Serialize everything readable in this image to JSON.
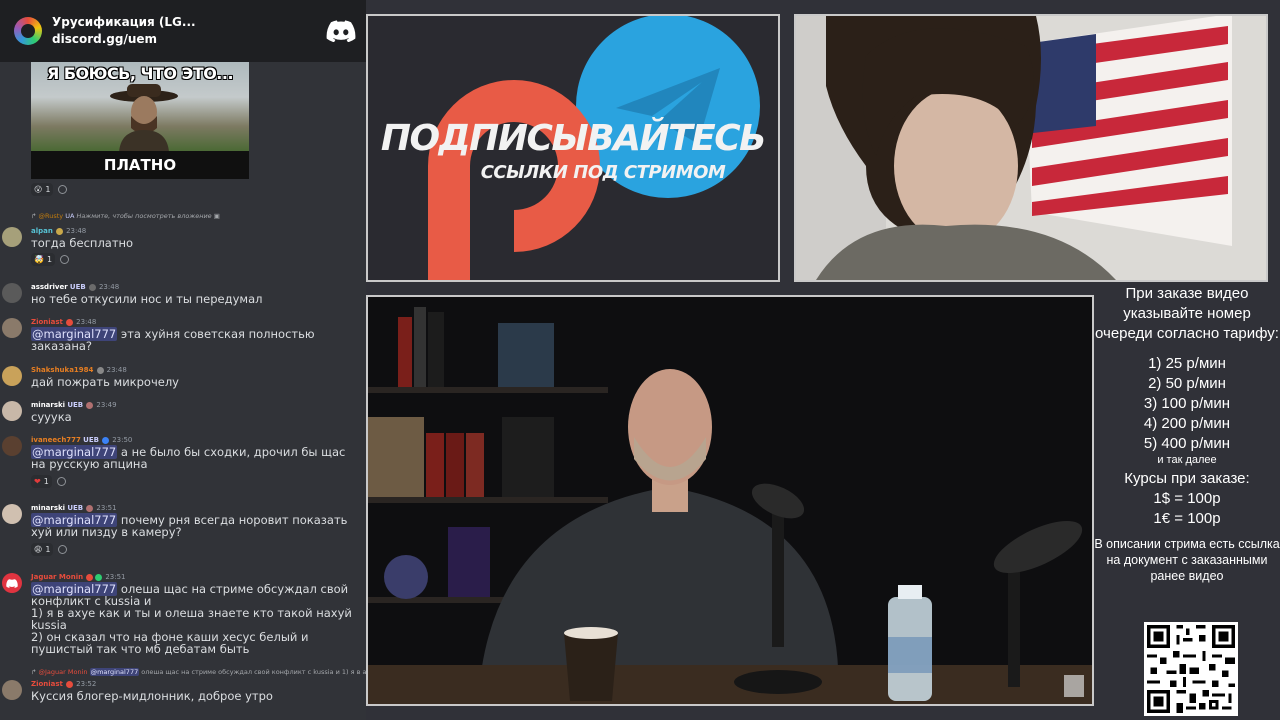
{
  "widget": {
    "server_name": "Урусификация (LG...",
    "invite": "discord.gg/uem"
  },
  "meme": {
    "top_text": "Я БОЮСЬ, ЧТО ЭТО...",
    "bottom_text": "ПЛАТНО",
    "reaction_count": "1"
  },
  "messages": {
    "m1": {
      "reply_user": "@Rusty",
      "reply_tag": "UA",
      "reply_text": "Нажмите, чтобы посмотреть вложение",
      "author": "alpan",
      "time": "23:48",
      "text": "тогда бесплатно",
      "reaction_count": "1"
    },
    "m2": {
      "author": "assdriver",
      "tag": "UEB",
      "time": "23:48",
      "text": "но тебе откусили нос и ты передумал"
    },
    "m3": {
      "author": "Zioniast",
      "time": "23:48",
      "mention": "@marginal777",
      "text": " эта хуйня советская полностью заказана?"
    },
    "m4": {
      "author": "Shakshuka1984",
      "time": "23:48",
      "text": "дай пожрать микрочелу"
    },
    "m5": {
      "author": "minarski",
      "tag": "UEB",
      "time": "23:49",
      "text": "сууука"
    },
    "m6": {
      "author": "ivaneech777",
      "tag": "UEB",
      "time": "23:50",
      "mention": "@marginal777",
      "text": " а не было бы сходки, дрочил бы щас на русскую апцина",
      "reaction_count": "1"
    },
    "m7": {
      "author": "minarski",
      "tag": "UEB",
      "time": "23:51",
      "mention": "@marginal777",
      "text": " почему рня всегда норовит показать хуй или пизду в камеру?",
      "reaction_count": "1"
    },
    "m8": {
      "author": "Jaguar Monin",
      "time": "23:51",
      "mention": "@marginal777",
      "text": " олеша щас на стриме обсуждал свой конфликт с kussia и\n1) я в ахуе как и ты и олеша знаете кто такой нахуй kussia\n2) он сказал что на фоне каши хесус белый и пушистый так что мб дебатам быть"
    },
    "m9": {
      "reply_user": "@Jaguar Monin",
      "reply_mention": "@marginal777",
      "reply_text": "олеша щас на стриме обсуждал свой конфликт с kussia и 1) я в ах",
      "author": "Zioniast",
      "time": "23:52",
      "text": "Куссия блогер-мидлонник, доброе утро"
    }
  },
  "promo": {
    "title": "ПОДПИСЫВАЙТЕСЬ",
    "subtitle": "ССЫЛКИ ПОД СТРИМОМ"
  },
  "info": {
    "intro": "При заказе видео указывайте номер очереди согласно тарифу:",
    "tariffs": [
      "1) 25 р/мин",
      "2) 50 р/мин",
      "3) 100 р/мин",
      "4) 200 р/мин",
      "5) 400 р/мин"
    ],
    "etc": "и так далее",
    "rates_title": "Курсы при заказе:",
    "rates": [
      "1$ = 100р",
      "1€ = 100р"
    ],
    "note": "В описании стрима есть ссылка на документ с заказанными ранее видео"
  },
  "colors": {
    "patreon": "#e85b46",
    "telegram": "#2aa3df",
    "discord_blurple": "#5865f2"
  }
}
